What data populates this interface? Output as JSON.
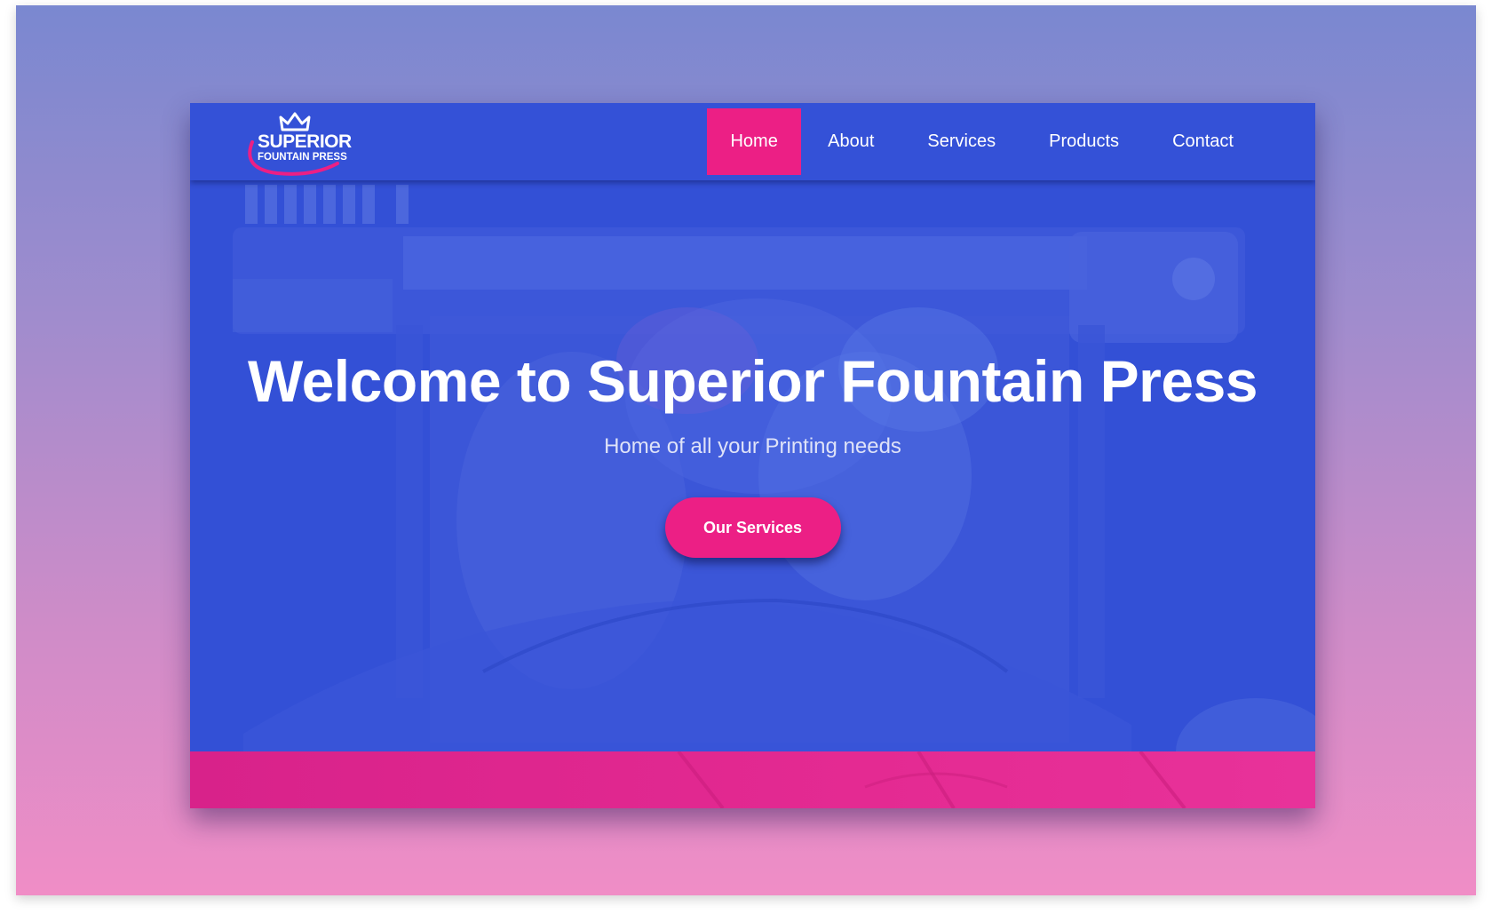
{
  "brand": {
    "logo_line1": "SUPERIOR",
    "logo_line2": "FOUNTAIN PRESS",
    "logo_icon": "crown-icon"
  },
  "nav": {
    "items": [
      {
        "label": "Home",
        "active": true
      },
      {
        "label": "About",
        "active": false
      },
      {
        "label": "Services",
        "active": false
      },
      {
        "label": "Products",
        "active": false
      },
      {
        "label": "Contact",
        "active": false
      }
    ]
  },
  "hero": {
    "title": "Welcome to Superior Fountain Press",
    "subtitle": "Home of all your Printing needs",
    "cta_label": "Our Services",
    "background_description_icon": "printer-photo-background"
  },
  "colors": {
    "primary_blue": "#3350d6",
    "accent_pink": "#ec1f85",
    "backdrop_top": "#7a88d0",
    "backdrop_bottom": "#f08dc6"
  }
}
